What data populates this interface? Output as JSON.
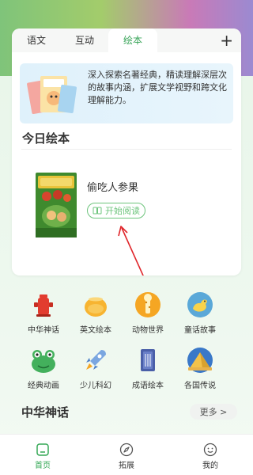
{
  "tabs": [
    {
      "label": "语文"
    },
    {
      "label": "互动"
    },
    {
      "label": "绘本"
    }
  ],
  "add_label": "+",
  "banner": {
    "text": "深入探索名著经典，精读理解深层次的故事内涵，扩展文学视野和跨文化理解能力。"
  },
  "today": {
    "section_title": "今日绘本",
    "book_title": "偷吃人参果",
    "read_label": "开始阅读"
  },
  "categories": [
    {
      "label": "中华神话"
    },
    {
      "label": "英文绘本"
    },
    {
      "label": "动物世界"
    },
    {
      "label": "童话故事"
    },
    {
      "label": "经典动画"
    },
    {
      "label": "少儿科幻"
    },
    {
      "label": "成语绘本"
    },
    {
      "label": "各国传说"
    }
  ],
  "bottom_section": {
    "title": "中华神话",
    "more_label": "更多 >"
  },
  "nav": [
    {
      "label": "首页"
    },
    {
      "label": "拓展"
    },
    {
      "label": "我的"
    }
  ],
  "colors": {
    "accent": "#35a856",
    "read_button": "#6dc47c"
  }
}
